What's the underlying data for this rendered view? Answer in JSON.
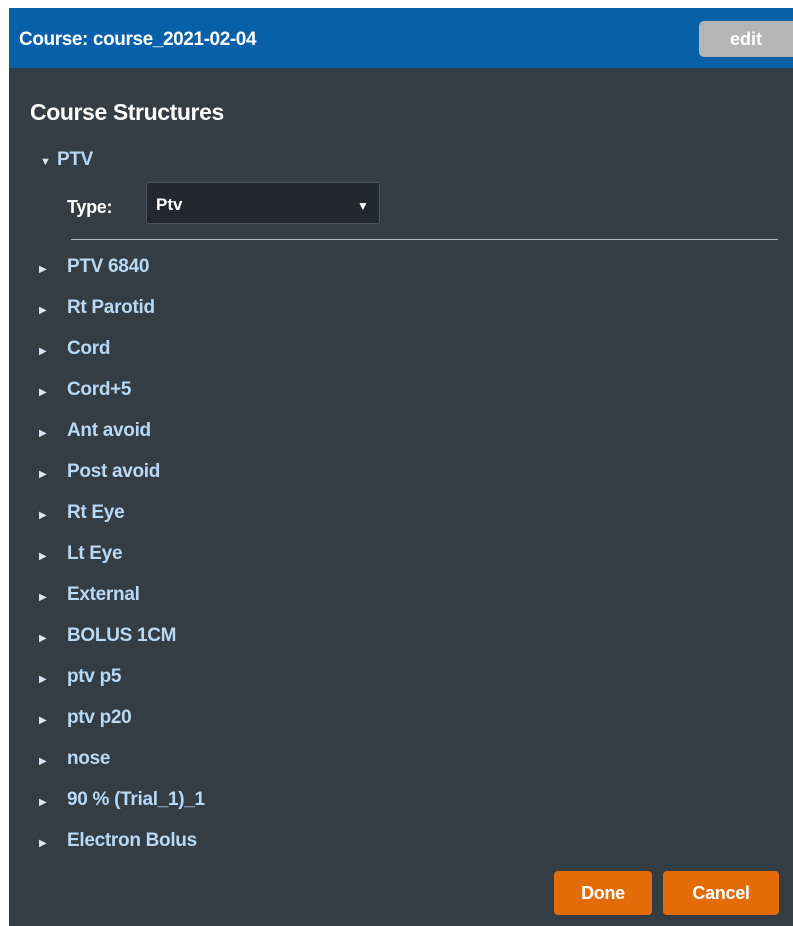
{
  "header": {
    "title": "Course: course_2021-02-04",
    "edit_label": "edit"
  },
  "section": {
    "title": "Course Structures"
  },
  "expanded_item": {
    "label": "PTV",
    "type_label": "Type:",
    "type_value": "Ptv"
  },
  "structures": [
    "PTV 6840",
    "Rt Parotid",
    "Cord",
    "Cord+5",
    "Ant avoid",
    "Post avoid",
    "Rt Eye",
    "Lt Eye",
    "External",
    "BOLUS 1CM",
    "ptv p5",
    "ptv p20",
    "nose",
    "90 % (Trial_1)_1",
    "Electron Bolus"
  ],
  "footer": {
    "done_label": "Done",
    "cancel_label": "Cancel"
  },
  "icons": {
    "collapsed": "caret-right-icon",
    "expanded": "caret-down-icon",
    "select": "caret-down-icon"
  },
  "colors": {
    "header_bg": "#0760a8",
    "panel_bg": "#343c44",
    "item_text": "#b8d8f4",
    "accent_button": "#e36c09",
    "edit_button": "#b5b5b5"
  }
}
